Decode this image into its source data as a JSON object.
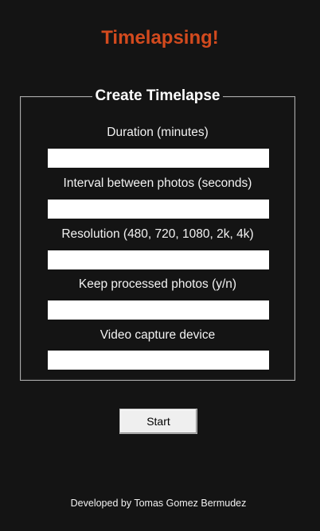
{
  "app": {
    "title": "Timelapsing!",
    "title_color": "#d24a1e",
    "background_color": "#141414"
  },
  "form": {
    "group_title": "Create Timelapse",
    "fields": [
      {
        "label": "Duration (minutes)",
        "value": ""
      },
      {
        "label": "Interval between photos (seconds)",
        "value": ""
      },
      {
        "label": "Resolution (480, 720, 1080, 2k, 4k)",
        "value": ""
      },
      {
        "label": "Keep processed photos (y/n)",
        "value": ""
      },
      {
        "label": "Video capture device",
        "value": ""
      }
    ],
    "start_label": "Start"
  },
  "footer": {
    "credit": "Developed by Tomas Gomez Bermudez"
  }
}
